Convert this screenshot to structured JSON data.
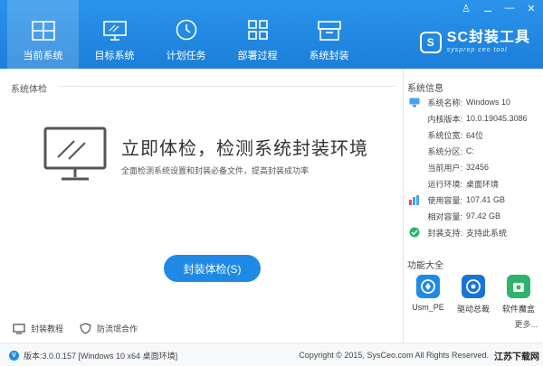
{
  "window": {
    "controls": [
      "♙",
      "⚊",
      "—",
      "✕"
    ]
  },
  "tabs": [
    {
      "label": "当前系统",
      "icon": "windows-icon",
      "active": true
    },
    {
      "label": "目标系统",
      "icon": "monitor-icon"
    },
    {
      "label": "计划任务",
      "icon": "clock-icon"
    },
    {
      "label": "部署过程",
      "icon": "deploy-icon"
    },
    {
      "label": "系统封装",
      "icon": "package-icon"
    }
  ],
  "logo": {
    "mark": "S",
    "title": "SC封装工具",
    "subtitle": "sysprep ceo tool"
  },
  "main": {
    "section_label": "系统体检",
    "headline": "立即体检，检测系统封装环境",
    "subline": "全面检测系统设置和封装必备文件，提高封装成功率",
    "check_button": "封装体检(S)",
    "footer_links": [
      {
        "label": "封装教程",
        "icon": "tutorial-icon"
      },
      {
        "label": "防流氓合作",
        "icon": "shield-icon"
      }
    ]
  },
  "side": {
    "title": "系统信息",
    "info": [
      {
        "key": "系统名称:",
        "value": "Windows 10",
        "icon": "monitor-icon"
      },
      {
        "key": "内核版本:",
        "value": "10.0.19045.3086"
      },
      {
        "key": "系统位宽:",
        "value": "64位"
      },
      {
        "key": "系统分区:",
        "value": "C:"
      },
      {
        "key": "当前用户:",
        "value": "32456"
      },
      {
        "key": "运行环境:",
        "value": "桌面环境"
      },
      {
        "key": "使用容量:",
        "value": "107.41 GB",
        "icon": "bar-chart-icon"
      },
      {
        "key": "相对容量:",
        "value": "97.42 GB"
      },
      {
        "key": "封装支持:",
        "value": "支持此系统",
        "icon": "check-circle-icon"
      }
    ],
    "func_title": "功能大全",
    "apps": [
      {
        "label": "Usm_PE",
        "color": "#1f8ae6"
      },
      {
        "label": "驱动总裁",
        "color": "#1a73d9"
      },
      {
        "label": "软件魔盒",
        "color": "#2db36b"
      }
    ],
    "more": "更多..."
  },
  "status": {
    "version": "版本:3.0.0.157 [Windows 10 x64 桌面环境]",
    "copyright": "Copyright © 2015, SysCeo.com All Rights Reserved.",
    "watermark": "江苏下载网"
  }
}
